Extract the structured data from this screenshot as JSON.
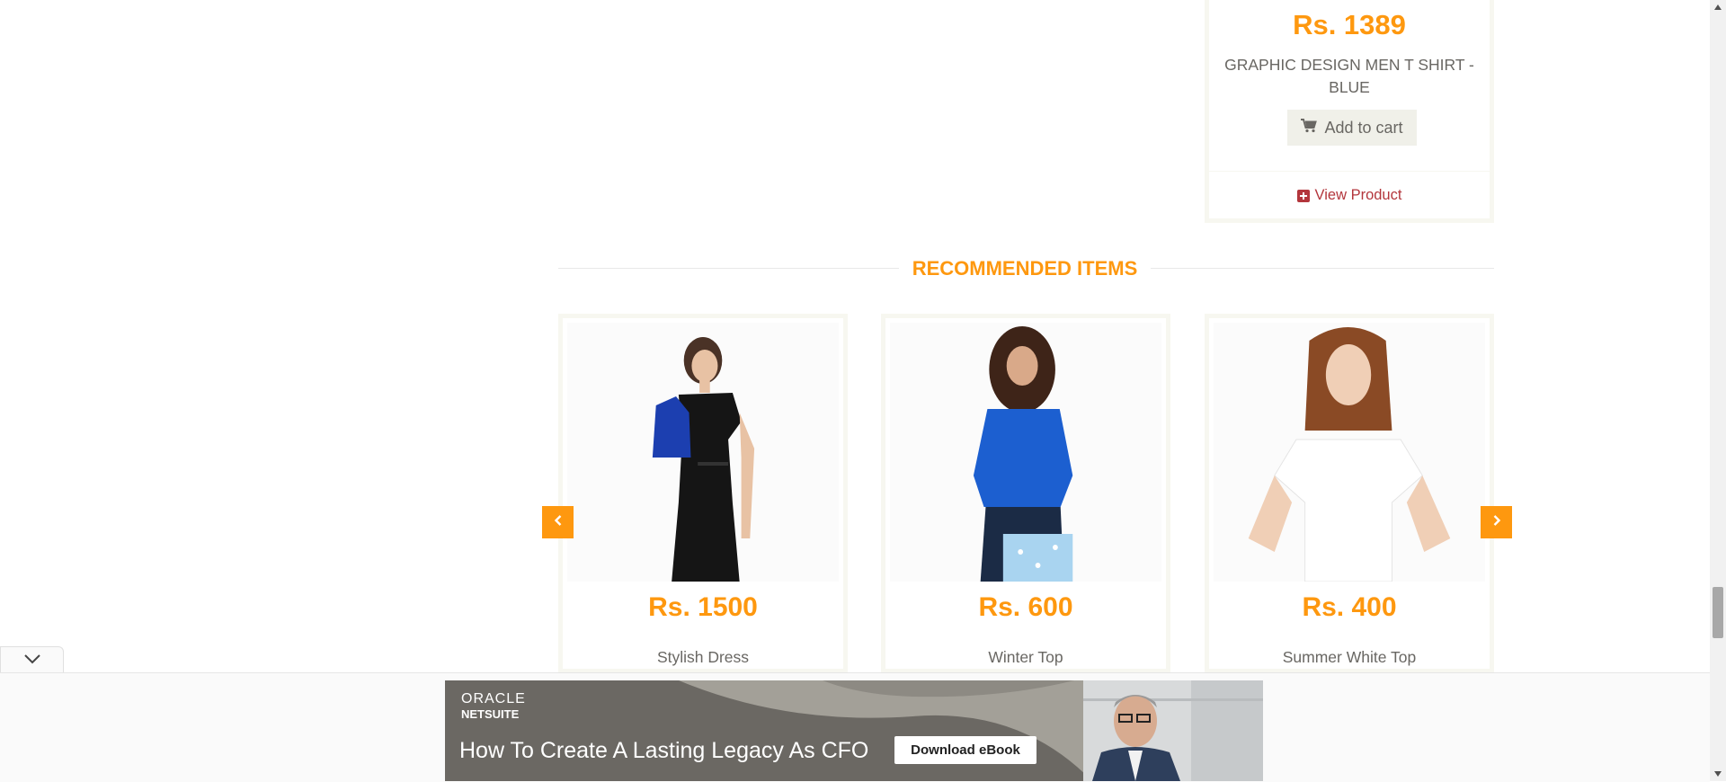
{
  "top_product": {
    "price": "Rs. 1389",
    "name": "GRAPHIC DESIGN MEN T SHIRT - BLUE",
    "add_to_cart": "Add to cart",
    "view_product": "View Product"
  },
  "recommended": {
    "title": "RECOMMENDED ITEMS",
    "items": [
      {
        "price": "Rs. 1500",
        "name": "Stylish Dress"
      },
      {
        "price": "Rs. 600",
        "name": "Winter Top"
      },
      {
        "price": "Rs. 400",
        "name": "Summer White Top"
      }
    ]
  },
  "ad": {
    "brand_line1": "ORACLE",
    "brand_line2": "NETSUITE",
    "headline": "How To Create A  Lasting Legacy As CFO",
    "cta": "Download eBook"
  },
  "colors": {
    "accent": "#FE980F",
    "button_bg": "#F0F0E9",
    "link": "#B3363C",
    "text": "#696763"
  },
  "icons": {
    "cart": "shopping-cart-icon",
    "view": "plus-square-icon",
    "prev": "chevron-left-icon",
    "next": "chevron-right-icon",
    "collapse": "chevron-down-icon"
  }
}
